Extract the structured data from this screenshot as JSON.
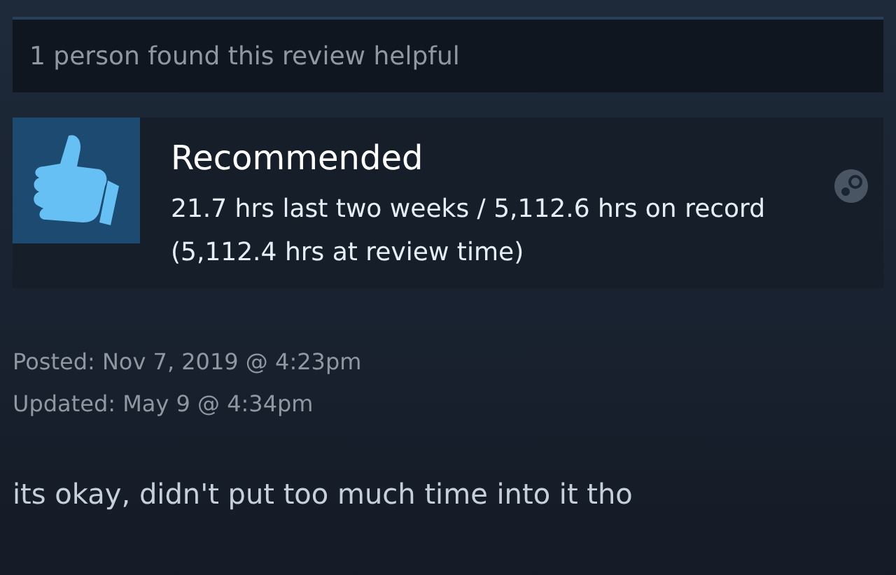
{
  "helpful": "1 person found this review helpful",
  "review": {
    "recommended": true,
    "verdict": "Recommended",
    "hours": "21.7 hrs last two weeks / 5,112.6 hrs on record (5,112.4 hrs at review time)"
  },
  "dates": [
    "Posted: Nov 7, 2019 @ 4:23pm",
    "Updated: May 9 @ 4:34pm"
  ],
  "body": "its okay, didn't put too much time into it tho"
}
